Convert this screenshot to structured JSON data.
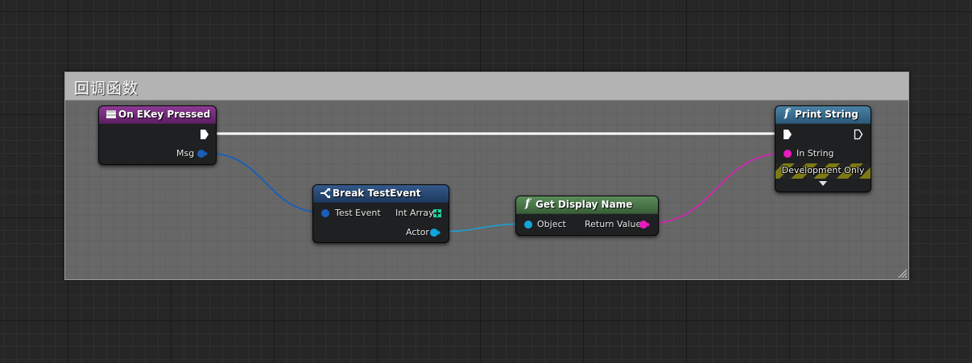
{
  "comment_box": {
    "title": "回调函数"
  },
  "nodes": {
    "on_key_pressed": {
      "title": "On EKey Pressed",
      "msg_label": "Msg",
      "header_color": "#7b2d81",
      "icon": "event-icon"
    },
    "break_event": {
      "title": "Break TestEvent",
      "test_event_label": "Test Event",
      "int_array_label": "Int Array",
      "actor_label": "Actor",
      "header_color": "#2a4a72",
      "icon": "break-struct-icon"
    },
    "get_display_name": {
      "title": "Get Display Name",
      "object_label": "Object",
      "return_value_label": "Return Value",
      "header_color": "#4e7a4e",
      "icon": "function-icon"
    },
    "print_string": {
      "title": "Print String",
      "in_string_label": "In String",
      "development_only_label": "Development Only",
      "header_color": "#3d6f8f",
      "icon": "function-icon"
    }
  },
  "colors": {
    "exec_wire": "#ffffff",
    "struct_wire": "#1a5fb8",
    "object_wire": "#14a4dc",
    "string_wire": "#e81bbd",
    "int_array_pin": "#1fd39a"
  }
}
